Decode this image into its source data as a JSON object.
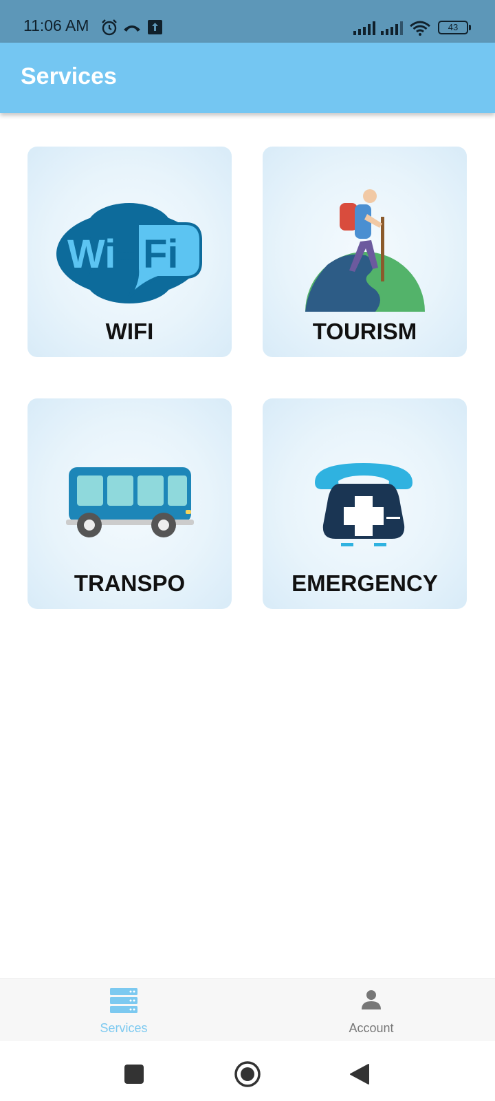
{
  "status_bar": {
    "time": "11:06 AM",
    "battery": "43",
    "icons": [
      "alarm-icon",
      "call-icon",
      "upload-icon",
      "signal-icon",
      "signal-icon",
      "wifi-icon",
      "battery-icon"
    ]
  },
  "app_bar": {
    "title": "Services"
  },
  "cards": [
    {
      "label": "WIFI",
      "icon": "wifi-logo-icon"
    },
    {
      "label": "TOURISM",
      "icon": "hiker-globe-icon"
    },
    {
      "label": "TRANSPO",
      "icon": "bus-icon"
    },
    {
      "label": "EMERGENCY",
      "icon": "emergency-phone-icon"
    }
  ],
  "bottom_nav": {
    "items": [
      {
        "label": "Services",
        "icon": "server-icon",
        "active": true,
        "color": "#7cc9f0"
      },
      {
        "label": "Account",
        "icon": "person-icon",
        "active": false,
        "color": "#777777"
      }
    ]
  },
  "system_nav": {
    "buttons": [
      "recents-button",
      "home-button",
      "back-button"
    ]
  },
  "colors": {
    "status_bar": "#5d97b8",
    "app_bar": "#74c6f2",
    "card_bg": "#e8f4fb",
    "accent": "#7cc9f0"
  }
}
